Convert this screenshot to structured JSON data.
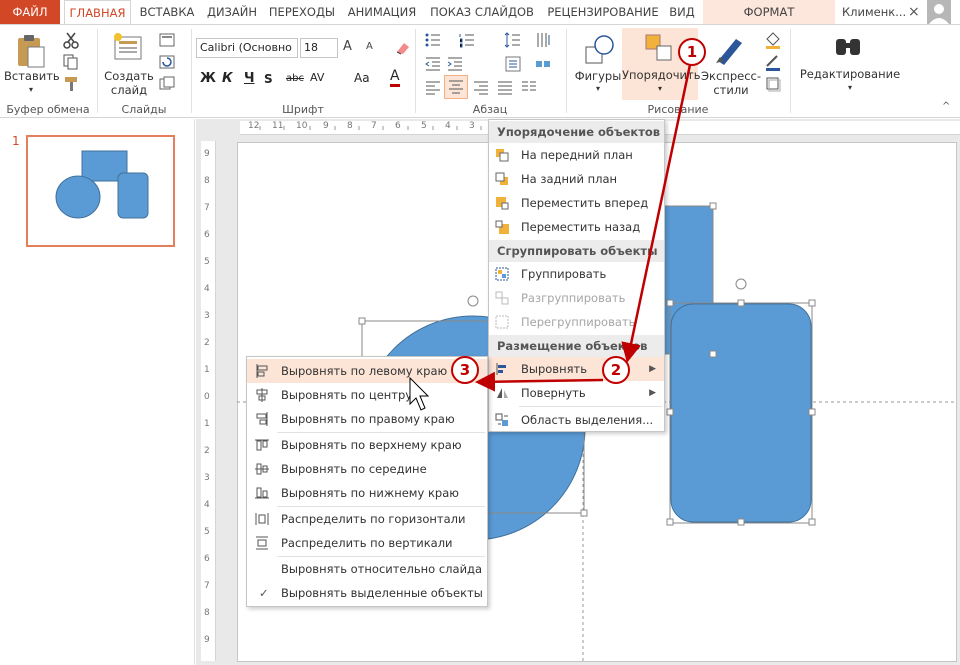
{
  "tabs": {
    "file": "ФАЙЛ",
    "home": "ГЛАВНАЯ",
    "insert": "ВСТАВКА",
    "design": "ДИЗАЙН",
    "transitions": "ПЕРЕХОДЫ",
    "animation": "АНИМАЦИЯ",
    "slideshow": "ПОКАЗ СЛАЙДОВ",
    "review": "РЕЦЕНЗИРОВАНИЕ",
    "view": "ВИД",
    "format": "ФОРМАТ"
  },
  "user": {
    "name": "Клименк...",
    "close": "×"
  },
  "ribbon": {
    "clipboard": {
      "paste": "Вставить",
      "label": "Буфер обмена"
    },
    "slides": {
      "new_slide": "Создать слайд",
      "new_slide_l1": "Создать",
      "new_slide_l2": "слайд",
      "label": "Слайды"
    },
    "font": {
      "name": "Calibri (Основно",
      "size": "18",
      "bold": "Ж",
      "italic": "К",
      "underline": "Ч",
      "strike": "abc",
      "spacing": "AV",
      "aa": "Aa",
      "color": "A",
      "grow": "A",
      "shrink": "A",
      "label": "Шрифт"
    },
    "paragraph": {
      "label": "Абзац"
    },
    "drawing": {
      "shapes": "Фигуры",
      "arrange": "Упорядочить",
      "quick_styles_l1": "Экспресс-",
      "quick_styles_l2": "стили",
      "label": "Рисование"
    },
    "editing": {
      "label": "Редактирование"
    }
  },
  "thumbnail": {
    "number": "1"
  },
  "hruler_ticks": [
    "12",
    "11",
    "10",
    "9",
    "8",
    "7",
    "6",
    "5",
    "4",
    "3",
    "2"
  ],
  "vruler_ticks": [
    "9",
    "8",
    "7",
    "6",
    "5",
    "4",
    "3",
    "2",
    "1",
    "0",
    "1",
    "2",
    "3",
    "4",
    "5",
    "6",
    "7",
    "8",
    "9"
  ],
  "arrange_menu": {
    "order_header": "Упорядочение объектов",
    "bring_front": "На передний план",
    "send_back": "На задний план",
    "bring_forward": "Переместить вперед",
    "send_backward": "Переместить назад",
    "group_header": "Сгруппировать объекты",
    "group": "Группировать",
    "ungroup": "Разгруппировать",
    "regroup": "Перегруппировать",
    "position_header": "Размещение объектов",
    "align": "Выровнять",
    "rotate": "Повернуть",
    "selection_pane": "Область выделения..."
  },
  "align_menu": {
    "left": "Выровнять по левому краю",
    "center": "Выровнять по центру",
    "right": "Выровнять по правому краю",
    "top": "Выровнять по верхнему краю",
    "middle": "Выровнять по середине",
    "bottom": "Выровнять по нижнему краю",
    "dist_h": "Распределить по горизонтали",
    "dist_v": "Распределить по вертикали",
    "rel_slide": "Выровнять относительно слайда",
    "rel_selected": "Выровнять выделенные объекты"
  },
  "badges": [
    "1",
    "2",
    "3"
  ],
  "colors": {
    "accent": "#d24726",
    "shape": "#5b9bd5",
    "shape_border": "#41719c",
    "annotation": "#c00000",
    "hover": "#fce4d6"
  }
}
